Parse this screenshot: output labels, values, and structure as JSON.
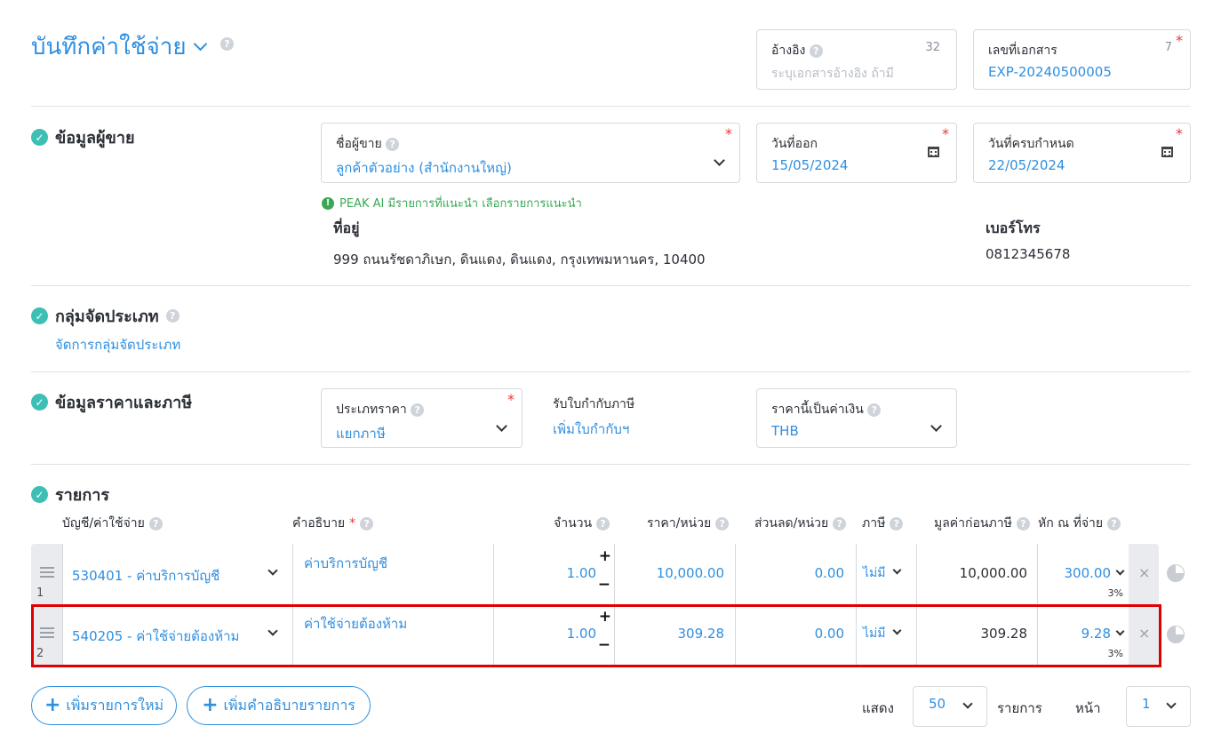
{
  "header": {
    "title": "บันทึกค่าใช้จ่าย",
    "reference": {
      "label": "อ้างอิง",
      "count": "32",
      "placeholder": "ระบุเอกสารอ้างอิง ถ้ามี"
    },
    "doc_number": {
      "label": "เลขที่เอกสาร",
      "count": "7",
      "value": "EXP-20240500005"
    }
  },
  "vendor_section": {
    "title": "ข้อมูลผู้ขาย",
    "vendor_name": {
      "label": "ชื่อผู้ขาย",
      "value": "ลูกค้าตัวอย่าง (สำนักงานใหญ่)"
    },
    "issue_date": {
      "label": "วันที่ออก",
      "value": "15/05/2024"
    },
    "due_date": {
      "label": "วันที่ครบกำหนด",
      "value": "22/05/2024"
    },
    "ai_hint": "PEAK AI มีรายการที่แนะนำ เลือกรายการแนะนำ",
    "address_label": "ที่อยู่",
    "address": "999 ถนนรัชดาภิเษก, ดินแดง, ดินแดง, กรุงเทพมหานคร, 10400",
    "phone_label": "เบอร์โทร",
    "phone": "0812345678"
  },
  "category_section": {
    "title": "กลุ่มจัดประเภท",
    "manage_link": "จัดการกลุ่มจัดประเภท"
  },
  "price_section": {
    "title": "ข้อมูลราคาและภาษี",
    "price_type": {
      "label": "ประเภทราคา",
      "value": "แยกภาษี"
    },
    "tax_invoice": {
      "label": "รับใบกำกับภาษี",
      "link": "เพิ่มใบกำกับฯ"
    },
    "currency": {
      "label": "ราคานี้เป็นค่าเงิน",
      "value": "THB"
    }
  },
  "items_section": {
    "title": "รายการ",
    "columns": {
      "account": "บัญชี/ค่าใช้จ่าย",
      "description": "คำอธิบาย",
      "qty": "จำนวน",
      "unit_price": "ราคา/หน่วย",
      "discount": "ส่วนลด/หน่วย",
      "tax": "ภาษี",
      "pre_tax": "มูลค่าก่อนภาษี",
      "wht": "หัก ณ ที่จ่าย"
    },
    "rows": [
      {
        "index": "1",
        "account": "530401 - ค่าบริการบัญชี",
        "description": "ค่าบริการบัญชี",
        "qty": "1.00",
        "unit_price": "10,000.00",
        "discount": "0.00",
        "tax": "ไม่มี",
        "pre_tax": "10,000.00",
        "wht": "300.00",
        "wht_rate": "3%"
      },
      {
        "index": "2",
        "account": "540205 - ค่าใช้จ่ายต้องห้าม",
        "description": "ค่าใช้จ่ายต้องห้าม",
        "qty": "1.00",
        "unit_price": "309.28",
        "discount": "0.00",
        "tax": "ไม่มี",
        "pre_tax": "309.28",
        "wht": "9.28",
        "wht_rate": "3%"
      }
    ],
    "add_item": "เพิ่มรายการใหม่",
    "add_description": "เพิ่มคำอธิบายรายการ",
    "show_label": "แสดง",
    "page_size": "50",
    "items_label": "รายการ",
    "page_label": "หน้า",
    "page": "1"
  },
  "colors": {
    "accent": "#2f8fe0",
    "check": "#3dbfb5",
    "highlight": "#e00000",
    "required": "#e53935"
  }
}
